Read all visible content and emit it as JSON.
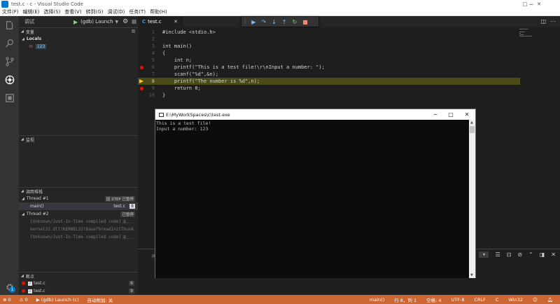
{
  "window": {
    "title": "test.c - c - Visual Studio Code",
    "controls": [
      "─",
      "□",
      "✕"
    ]
  },
  "menu": [
    "文件(F)",
    "编辑(E)",
    "选择(S)",
    "查看(V)",
    "转到(G)",
    "调试(D)",
    "任务(T)",
    "帮助(H)"
  ],
  "debug": {
    "view_title": "调试",
    "config": "(gdb) Launch"
  },
  "sidebar": {
    "variables": {
      "title": "变量",
      "locals_label": "Locals",
      "vars": [
        {
          "name": "n:",
          "value": "123"
        }
      ]
    },
    "watch": {
      "title": "监视"
    },
    "callstack": {
      "title": "调用堆栈",
      "threads": [
        {
          "label": "Thread #1",
          "badge": "因 STEP 已暂停",
          "frames": [
            {
              "name": "main()",
              "file": "test.c",
              "line": "8"
            }
          ]
        },
        {
          "label": "Thread #2",
          "badge": "已暂停",
          "frames": [
            {
              "name": "[Unknown/Just-In-Time compiled code]",
              "suffix": "未..."
            },
            {
              "name": "kernel32.dll!KERNEL32!BaseThreadInitThunk"
            },
            {
              "name": "[Unknown/Just-In-Time compiled code]",
              "suffix": "未..."
            }
          ]
        }
      ]
    },
    "breakpoints": {
      "title": "断点",
      "items": [
        {
          "file": "test.c",
          "line": "6"
        },
        {
          "file": "test.c",
          "line": "9"
        }
      ]
    }
  },
  "editor": {
    "tab": {
      "icon": "C",
      "name": "test.c"
    },
    "lines": [
      {
        "n": "1",
        "html_kind": "pp",
        "text": "#include <stdio.h>"
      },
      {
        "n": "2",
        "text": ""
      },
      {
        "n": "3",
        "text": "int main()"
      },
      {
        "n": "4",
        "text": "{"
      },
      {
        "n": "5",
        "text": "    int n;"
      },
      {
        "n": "6",
        "text": "    printf(\"This is a test file!\\r\\nInput a number: \");"
      },
      {
        "n": "7",
        "text": "    scanf(\"%d\",&n);"
      },
      {
        "n": "8",
        "text": "    printf(\"The number is %d\",n);"
      },
      {
        "n": "9",
        "text": "    return 0;"
      },
      {
        "n": "10",
        "text": "}"
      }
    ]
  },
  "console": {
    "title": "E:\\MyWorkSpaces\\c\\test.exe",
    "output": [
      "This is a test file!",
      "Input a number: 123"
    ]
  },
  "panel": {
    "label": "问"
  },
  "status": {
    "errors": "0",
    "warnings": "0",
    "debug_config": "(gdb) Launch (c)",
    "auto_attach": "自动附加: 关",
    "branch": "main()",
    "position": "行 8，列 1",
    "spaces": "空格: 4",
    "encoding": "UTF-8",
    "eol": "CRLF",
    "language": "C",
    "platform": "Win32",
    "notifications": "1"
  },
  "colors": {
    "statusbar": "#cc6633",
    "breakpoint": "#e51400",
    "current_line": "#4b4b18"
  }
}
